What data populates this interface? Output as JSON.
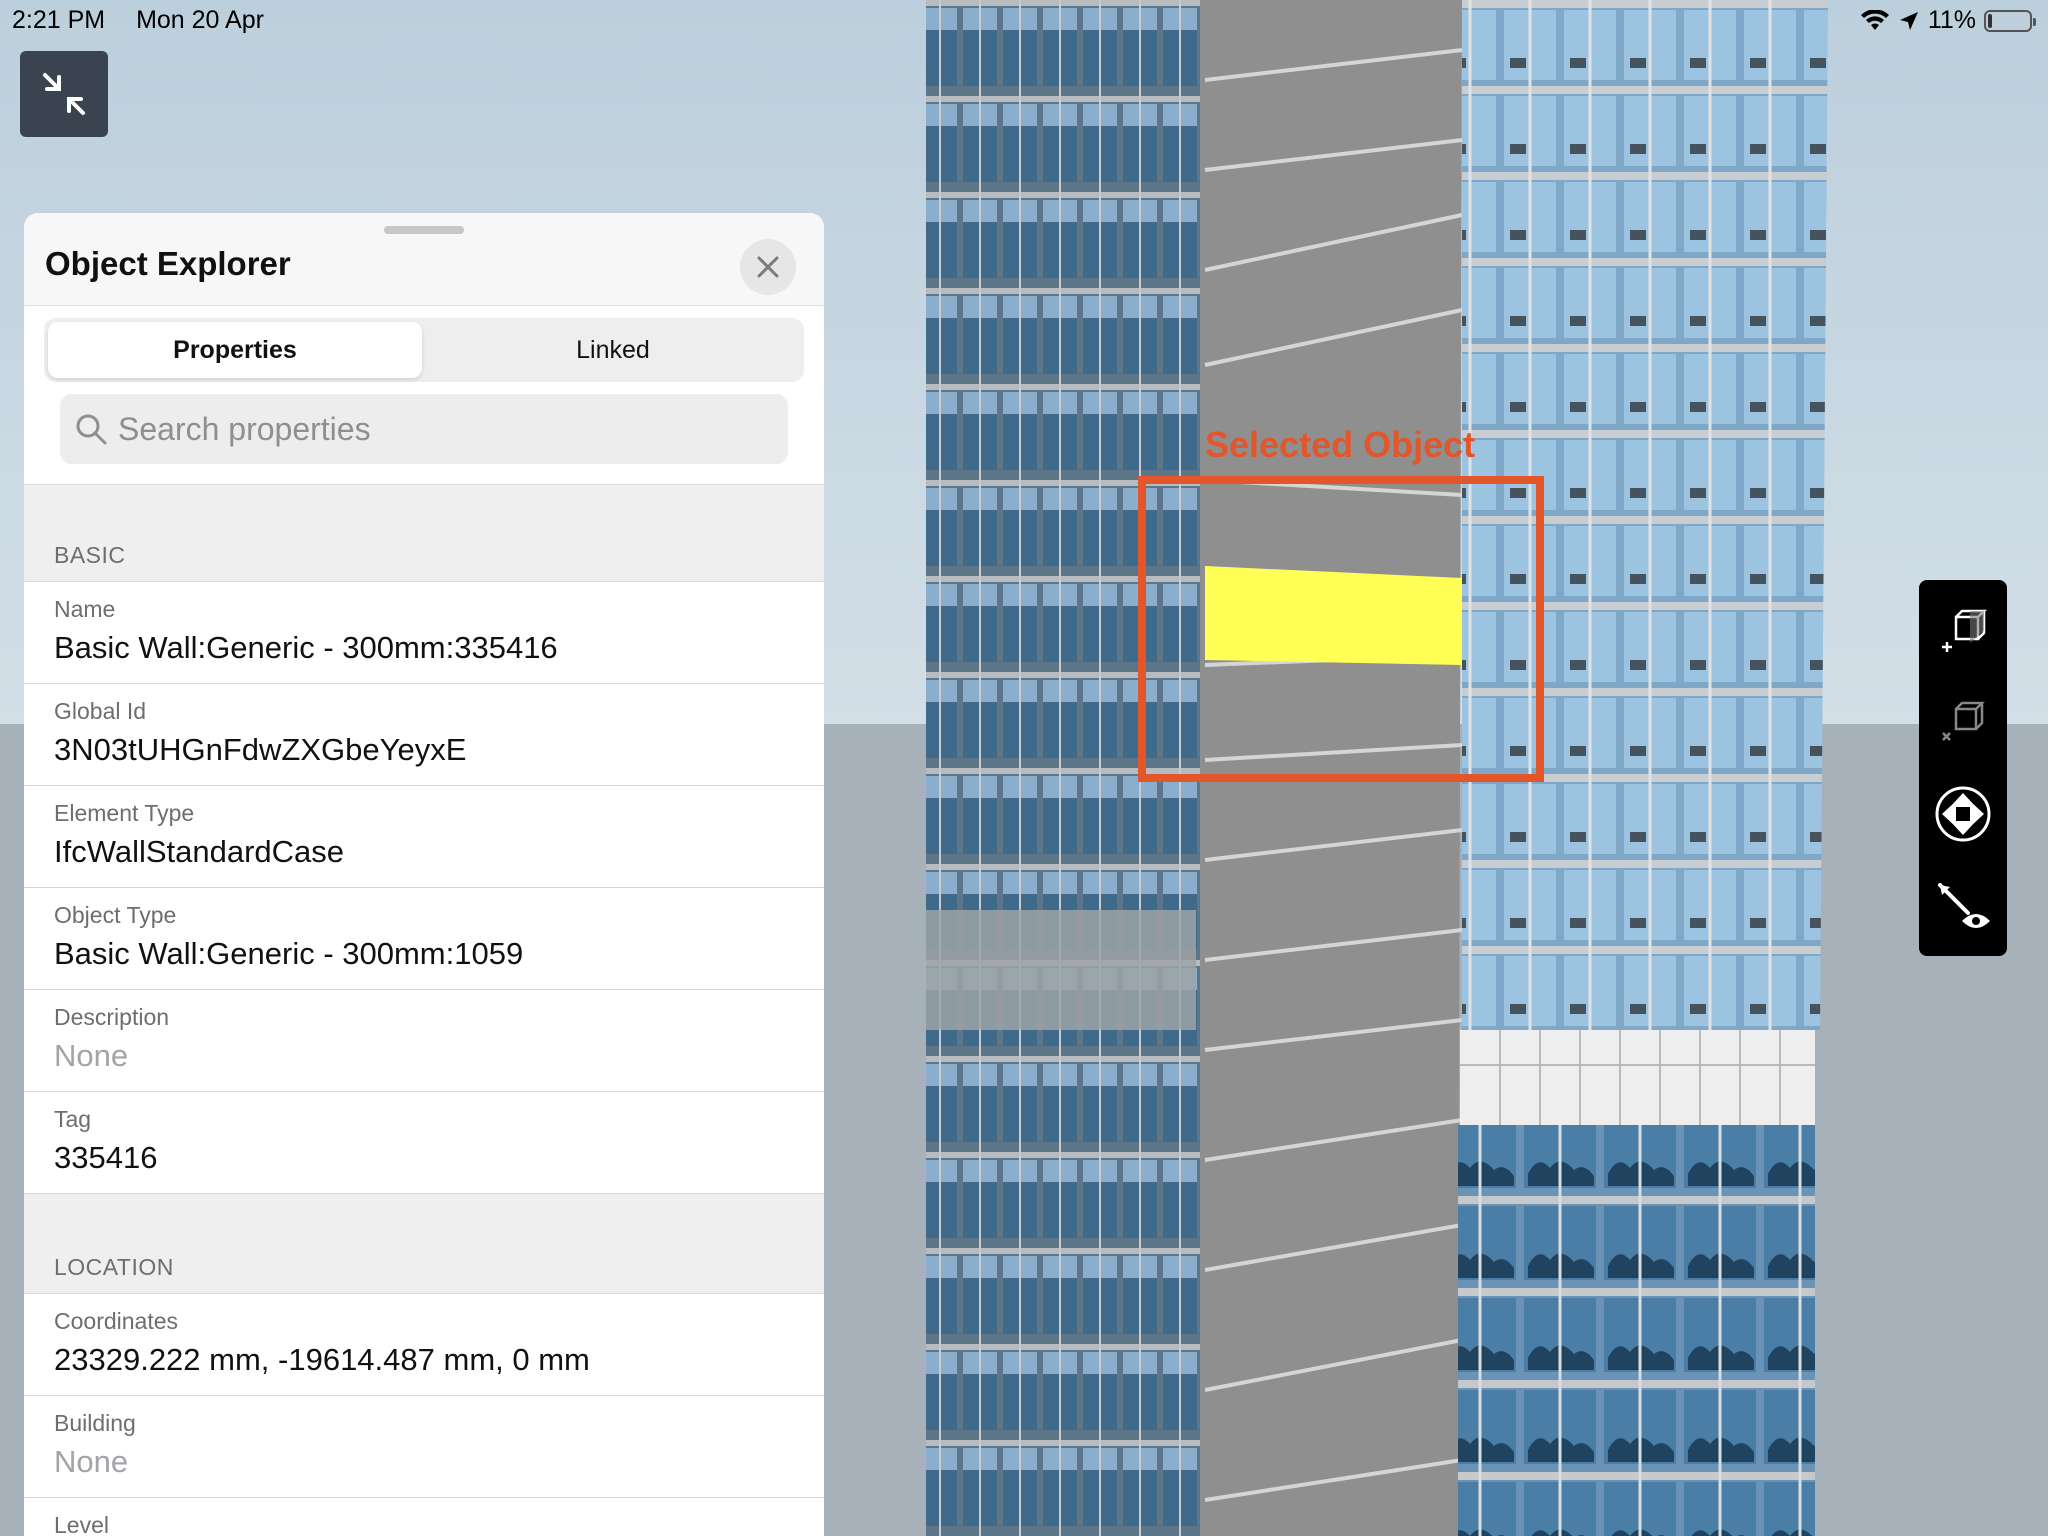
{
  "status_bar": {
    "time": "2:21 PM",
    "date": "Mon 20 Apr",
    "battery_text": "11%",
    "battery_level": 0.11
  },
  "viewer": {
    "minimize_icon": "minimize-arrows-icon",
    "annotation_label": "Selected Object",
    "annotation_color": "#e2562a",
    "highlight_color": "#ffff55",
    "tools": [
      {
        "name": "add-to-section-icon"
      },
      {
        "name": "remove-from-section-icon"
      },
      {
        "name": "orbit-navigation-icon"
      },
      {
        "name": "measure-visibility-icon"
      }
    ]
  },
  "panel": {
    "title": "Object Explorer",
    "close_icon": "close-icon",
    "tabs": [
      {
        "label": "Properties",
        "active": true
      },
      {
        "label": "Linked",
        "active": false
      }
    ],
    "search": {
      "placeholder": "Search properties"
    },
    "sections": [
      {
        "header": "BASIC",
        "rows": [
          {
            "label": "Name",
            "value": "Basic Wall:Generic - 300mm:335416"
          },
          {
            "label": "Global Id",
            "value": "3N03tUHGnFdwZXGbeYeyxE"
          },
          {
            "label": "Element Type",
            "value": "IfcWallStandardCase"
          },
          {
            "label": "Object Type",
            "value": "Basic Wall:Generic - 300mm:1059"
          },
          {
            "label": "Description",
            "value": "None"
          },
          {
            "label": "Tag",
            "value": "335416"
          }
        ]
      },
      {
        "header": "LOCATION",
        "rows": [
          {
            "label": "Coordinates",
            "value": "23329.222 mm, -19614.487 mm, 0 mm"
          },
          {
            "label": "Building",
            "value": "None"
          },
          {
            "label": "Level",
            "value": ""
          }
        ]
      }
    ]
  }
}
